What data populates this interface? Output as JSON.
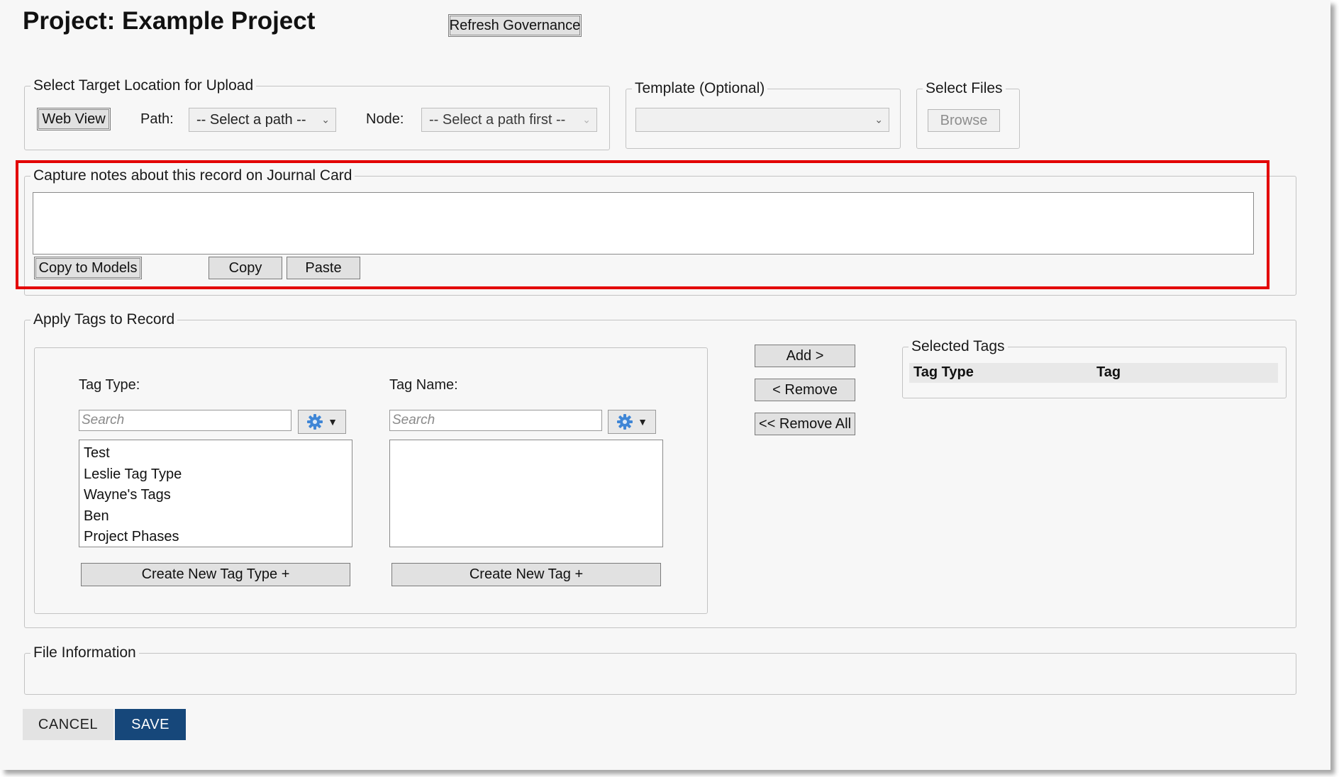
{
  "header": {
    "title": "Project: Example Project",
    "refresh_button": "Refresh Governance"
  },
  "target_location": {
    "legend": "Select Target Location for Upload",
    "web_view_button": "Web View",
    "path_label": "Path:",
    "path_value": "-- Select a path --",
    "node_label": "Node:",
    "node_value": "-- Select a path first --"
  },
  "template": {
    "legend": "Template (Optional)",
    "value": ""
  },
  "select_files": {
    "legend": "Select Files",
    "browse_button": "Browse"
  },
  "journal": {
    "legend": "Capture notes about this record on Journal Card",
    "notes_value": "",
    "copy_to_models_button": "Copy to Models",
    "copy_button": "Copy",
    "paste_button": "Paste"
  },
  "tags": {
    "legend": "Apply Tags to Record",
    "tag_type_label": "Tag Type:",
    "tag_type_search_placeholder": "Search",
    "tag_type_items": [
      "Test",
      "Leslie Tag Type",
      "Wayne's Tags",
      "Ben",
      "Project Phases"
    ],
    "create_tag_type_button": "Create New Tag Type +",
    "tag_name_label": "Tag Name:",
    "tag_name_search_placeholder": "Search",
    "create_tag_button": "Create New Tag +",
    "add_button": "Add >",
    "remove_button": "< Remove",
    "remove_all_button": "<< Remove All",
    "selected_legend": "Selected Tags",
    "selected_columns": [
      "Tag Type",
      "Tag"
    ]
  },
  "file_info": {
    "legend": "File Information"
  },
  "footer": {
    "cancel_button": "CANCEL",
    "save_button": "SAVE"
  },
  "colors": {
    "highlight": "#e30000",
    "save_bg": "#16477a"
  },
  "icons": {
    "gear": "gear-icon",
    "dropdown": "chevron-down-icon"
  }
}
